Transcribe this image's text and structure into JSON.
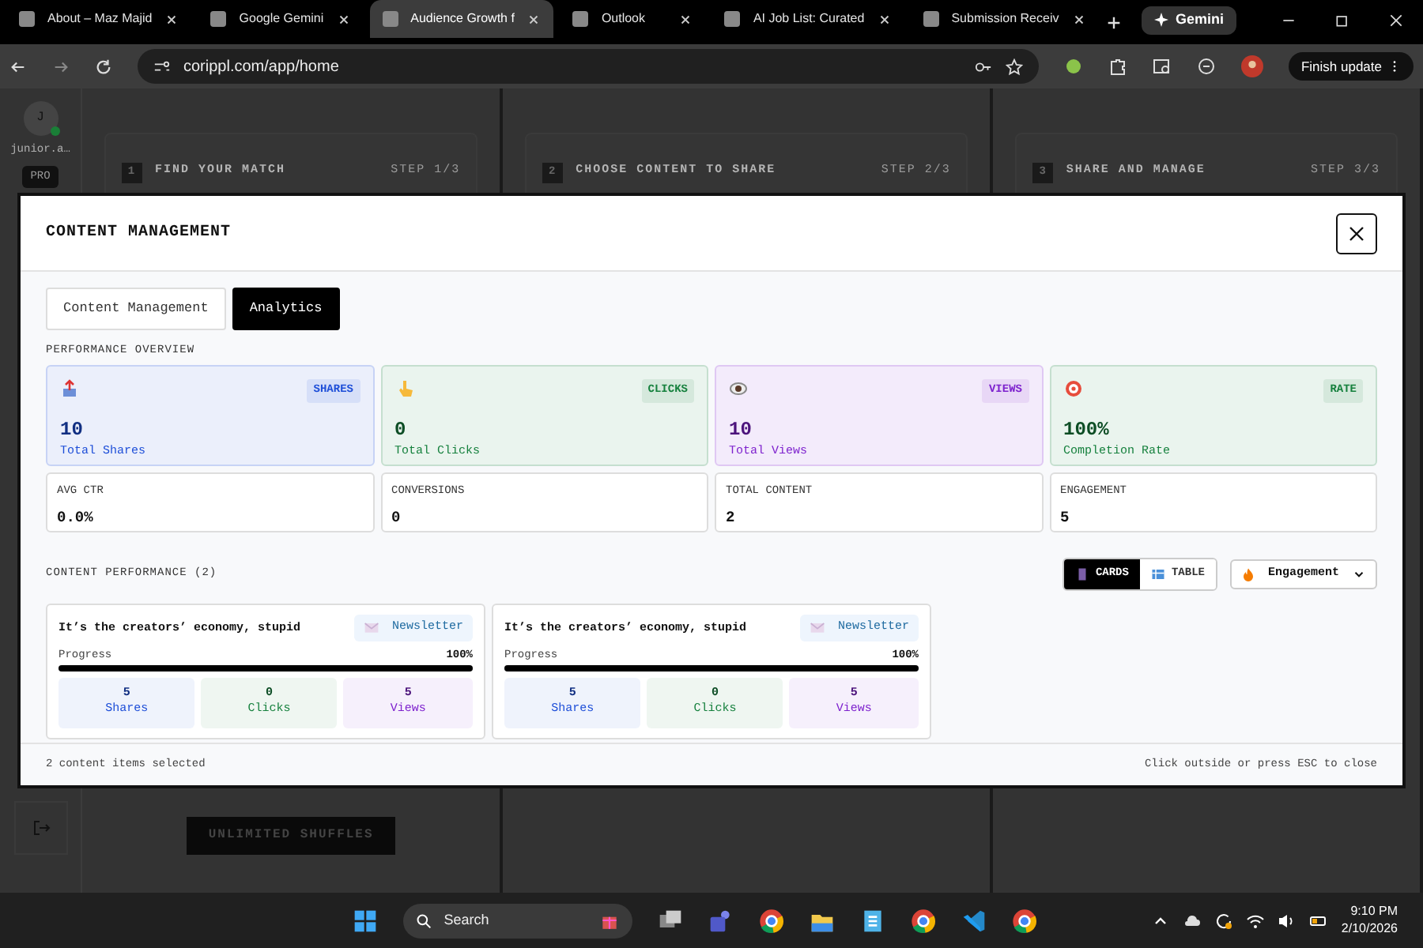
{
  "browser": {
    "tabs": [
      {
        "title": "About – Maz Majid",
        "selected": false
      },
      {
        "title": "Google Gemini",
        "selected": false
      },
      {
        "title": "Audience Growth f",
        "selected": true
      },
      {
        "title": "Outlook",
        "selected": false
      },
      {
        "title": "AI Job List: Curated",
        "selected": false
      },
      {
        "title": "Submission Receiv",
        "selected": false
      }
    ],
    "gemini_button": "Gemini",
    "address": "corippl.com/app/home",
    "update_button": "Finish update"
  },
  "app": {
    "sidebar": {
      "avatar_initial": "J",
      "user": "junior.a…",
      "plan_badge": "PRO"
    },
    "steps": [
      {
        "number": "1",
        "title": "FIND YOUR MATCH",
        "step": "STEP 1/3"
      },
      {
        "number": "2",
        "title": "CHOOSE CONTENT TO SHARE",
        "step": "STEP 2/3"
      },
      {
        "number": "3",
        "title": "SHARE AND MANAGE",
        "step": "STEP 3/3"
      }
    ],
    "shuffle_button": "UNLIMITED SHUFFLES"
  },
  "modal": {
    "title": "CONTENT MANAGEMENT",
    "tabs": [
      {
        "label": "Content Management",
        "selected": false
      },
      {
        "label": "Analytics",
        "selected": true
      }
    ],
    "overview_title": "PERFORMANCE OVERVIEW",
    "stat_cards": [
      {
        "badge": "SHARES",
        "value": "10",
        "label": "Total Shares",
        "color": "#1d4ed8",
        "kind": "share"
      },
      {
        "badge": "CLICKS",
        "value": "0",
        "label": "Total Clicks",
        "color": "#15803d",
        "kind": "click"
      },
      {
        "badge": "VIEWS",
        "value": "10",
        "label": "Total Views",
        "color": "#7e22ce",
        "kind": "view"
      },
      {
        "badge": "RATE",
        "value": "100%",
        "label": "Completion Rate",
        "color": "#15803d",
        "kind": "rate"
      }
    ],
    "metric_cards": [
      {
        "label": "AVG CTR",
        "value": "0.0%"
      },
      {
        "label": "CONVERSIONS",
        "value": "0"
      },
      {
        "label": "TOTAL CONTENT",
        "value": "2"
      },
      {
        "label": "ENGAGEMENT",
        "value": "5"
      }
    ],
    "performance_title": "CONTENT PERFORMANCE (2)",
    "view_toggle": [
      {
        "label": "CARDS",
        "selected": true
      },
      {
        "label": "TABLE",
        "selected": false
      }
    ],
    "sort_select": "Engagement",
    "items": [
      {
        "title": "It’s the creators’ economy, stupid",
        "tag": "Newsletter",
        "progress_label": "Progress",
        "progress_text": "100%",
        "level": 1,
        "stats": [
          {
            "value": "5",
            "label": "Shares",
            "color": "#1d4ed8"
          },
          {
            "value": "0",
            "label": "Clicks",
            "color": "#15803d"
          },
          {
            "value": "5",
            "label": "Views",
            "color": "#7e22ce"
          }
        ]
      },
      {
        "title": "It’s the creators’ economy, stupid",
        "tag": "Newsletter",
        "progress_label": "Progress",
        "progress_text": "100%",
        "level": 1,
        "stats": [
          {
            "value": "5",
            "label": "Shares",
            "color": "#1d4ed8"
          },
          {
            "value": "0",
            "label": "Clicks",
            "color": "#15803d"
          },
          {
            "value": "5",
            "label": "Views",
            "color": "#7e22ce"
          }
        ]
      }
    ],
    "footer_left": "2 content items selected",
    "footer_right": "Click outside or press ESC to close"
  },
  "taskbar": {
    "search": "Search",
    "time": "9:10 PM",
    "date": "2/10/2026"
  }
}
